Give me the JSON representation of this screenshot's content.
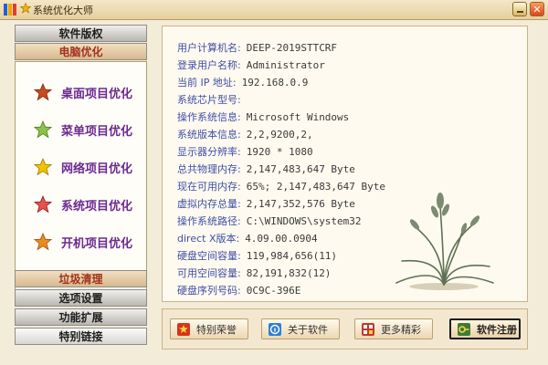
{
  "window": {
    "title": "系统优化大师"
  },
  "sidebar": {
    "top_buttons": [
      "软件版权",
      "电脑优化"
    ],
    "menu": [
      {
        "label": "桌面项目优化",
        "icon": "star-icon",
        "color": "#c84a1f"
      },
      {
        "label": "菜单项目优化",
        "icon": "star-icon",
        "color": "#8bc34a"
      },
      {
        "label": "网络项目优化",
        "icon": "star-icon",
        "color": "#f2c300"
      },
      {
        "label": "系统项目优化",
        "icon": "star-icon",
        "color": "#e84f4f"
      },
      {
        "label": "开机项目优化",
        "icon": "star-icon",
        "color": "#f08a1b"
      }
    ],
    "bottom_buttons": [
      "垃圾清理",
      "选项设置",
      "功能扩展",
      "特别链接"
    ]
  },
  "info": [
    {
      "key": "用户计算机名:",
      "value": "DEEP-2019STTCRF"
    },
    {
      "key": "登录用户名称:",
      "value": "Administrator"
    },
    {
      "key": "当前 IP 地址:",
      "value": "192.168.0.9"
    },
    {
      "key": "系统芯片型号:",
      "value": ""
    },
    {
      "key": "操作系统信息:",
      "value": "Microsoft Windows"
    },
    {
      "key": "系统版本信息:",
      "value": "2,2,9200,2,"
    },
    {
      "key": "显示器分辨率:",
      "value": "1920 * 1080"
    },
    {
      "key": "总共物理内存:",
      "value": "2,147,483,647 Byte"
    },
    {
      "key": "现在可用内存:",
      "value": "65%;  2,147,483,647 Byte"
    },
    {
      "key": "虚拟内存总量:",
      "value": "2,147,352,576 Byte"
    },
    {
      "key": "操作系统路径:",
      "value": "C:\\WINDOWS\\system32"
    },
    {
      "key": "direct X版本:",
      "value": "4.09.00.0904"
    },
    {
      "key": "硬盘空间容量:",
      "value": "119,984,656(11)"
    },
    {
      "key": "可用空间容量:",
      "value": "82,191,832(12)"
    },
    {
      "key": "硬盘序列号码:",
      "value": "0C9C-396E"
    }
  ],
  "footer": {
    "buttons": [
      {
        "label": "特别荣誉",
        "icon": "trophy-icon"
      },
      {
        "label": "关于软件",
        "icon": "info-icon"
      },
      {
        "label": "更多精彩",
        "icon": "grid-icon"
      },
      {
        "label": "软件注册",
        "icon": "key-icon"
      }
    ]
  }
}
